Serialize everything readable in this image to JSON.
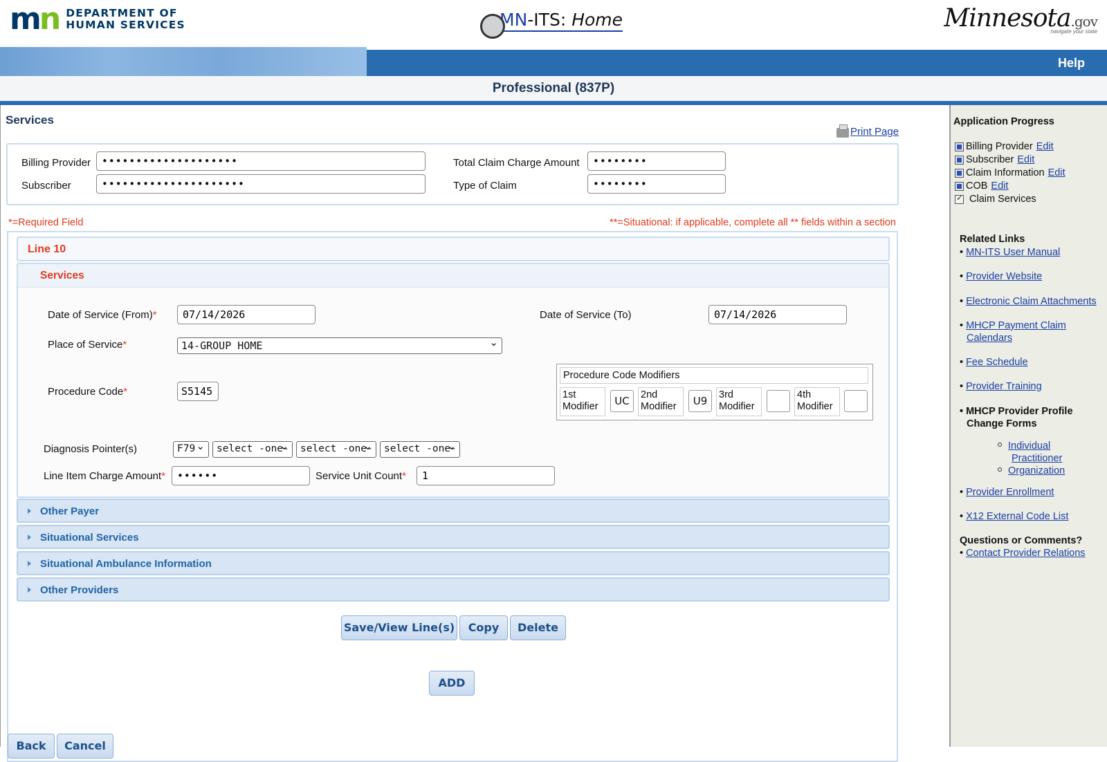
{
  "header": {
    "dept_line1": "DEPARTMENT OF",
    "dept_line2": "HUMAN SERVICES",
    "logo_mn": "mn",
    "app_title_mn": "MN",
    "app_title_rest": "-ITS: ",
    "app_title_home": "Home",
    "state_logo": "Minnesota",
    "state_logo_suffix": ".gov",
    "state_tagline": "navigate your state",
    "help_label": "Help",
    "page_title": "Professional (837P)"
  },
  "main": {
    "section_title": "Services",
    "print_label": "Print Page",
    "summary": {
      "billing_provider_label": "Billing Provider",
      "billing_provider_value": "••••••••••••••••••••",
      "subscriber_label": "Subscriber",
      "subscriber_value": "•••••••••••••••••••••",
      "total_charge_label": "Total Claim Charge Amount",
      "total_charge_value": "••••••••",
      "type_of_claim_label": "Type of Claim",
      "type_of_claim_value": "••••••••"
    },
    "required_note": "*=Required Field",
    "situational_note": "**=Situational: if applicable, complete all ** fields within a section",
    "line_title": "Line 10",
    "services_title": "Services",
    "fields": {
      "dos_from_label": "Date of Service (From)",
      "dos_from_value": "07/14/2026",
      "dos_to_label": "Date of Service (To)",
      "dos_to_value": "07/14/2026",
      "place_label": "Place of Service",
      "place_value": "14-GROUP HOME",
      "proc_label": "Procedure Code",
      "proc_value": "S5145",
      "diag_label": "Diagnosis Pointer(s)",
      "diag_values": [
        "F79",
        "select -one-",
        "select -one-",
        "select -one-"
      ],
      "charge_label": "Line Item Charge Amount",
      "charge_value": "••••••",
      "units_label": "Service Unit Count",
      "units_value": "1",
      "required_marker": "*"
    },
    "modifiers": {
      "title": "Procedure Code Modifiers",
      "items": [
        {
          "label1": "1st",
          "label2": "Modifier",
          "value": "UC"
        },
        {
          "label1": "2nd",
          "label2": "Modifier",
          "value": "U9"
        },
        {
          "label1": "3rd",
          "label2": "Modifier",
          "value": ""
        },
        {
          "label1": "4th",
          "label2": "Modifier",
          "value": ""
        }
      ]
    },
    "accordions": [
      "Other Payer",
      "Situational Services",
      "Situational Ambulance Information",
      "Other Providers"
    ],
    "buttons": {
      "save_view": "Save/View Line(s)",
      "copy": "Copy",
      "delete": "Delete",
      "add": "ADD",
      "back": "Back",
      "cancel": "Cancel"
    }
  },
  "sidebar": {
    "progress_title": "Application Progress",
    "progress_items": [
      {
        "label": "Billing Provider",
        "link": "Edit"
      },
      {
        "label": "Subscriber",
        "link": "Edit"
      },
      {
        "label": "Claim Information",
        "link": "Edit"
      },
      {
        "label": "COB",
        "link": "Edit"
      },
      {
        "label": "Claim Services",
        "link": ""
      }
    ],
    "related_title": "Related Links",
    "links": [
      "MN-ITS User Manual",
      "Provider Website",
      "Electronic Claim Attachments",
      "MHCP Payment Claim Calendars",
      "Fee Schedule",
      "Provider Training"
    ],
    "profile_heading": "MHCP Provider Profile Change Forms",
    "profile_sub": [
      "Individual Practitioner",
      "Organization"
    ],
    "links2": [
      "Provider Enrollment",
      "X12 External Code List"
    ],
    "questions_title": "Questions or Comments?",
    "contact_link": "Contact Provider Relations",
    "bullet": "•"
  }
}
